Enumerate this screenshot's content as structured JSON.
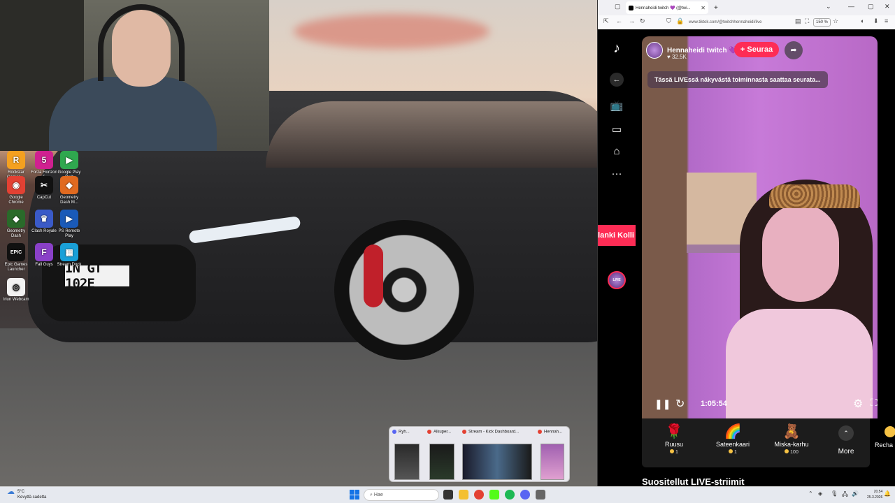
{
  "desktop": {
    "icons": [
      {
        "label": "Rockstar Games ...",
        "color": "#f4a020",
        "glyph": "R"
      },
      {
        "label": "Forza Horizon 5",
        "color": "#d02090",
        "glyph": "5"
      },
      {
        "label": "Google Play Pelit",
        "color": "#2fa84f",
        "glyph": "▶"
      },
      {
        "label": "Google Chrome",
        "color": "#e34133",
        "glyph": "◉"
      },
      {
        "label": "CapCut",
        "color": "#111111",
        "glyph": "✂"
      },
      {
        "label": "Geometry Dash M...",
        "color": "#e06a20",
        "glyph": "◆"
      },
      {
        "label": "Geometry Dash",
        "color": "#2a6a2a",
        "glyph": "◆"
      },
      {
        "label": "Clash Royale",
        "color": "#3a5ac8",
        "glyph": "♛"
      },
      {
        "label": "PS Remote Play",
        "color": "#1a5ab8",
        "glyph": "▶"
      },
      {
        "label": "Epic Games Launcher",
        "color": "#111111",
        "glyph": "EPIC"
      },
      {
        "label": "Fall Guys",
        "color": "#8a40c8",
        "glyph": "F"
      },
      {
        "label": "Stream Dock",
        "color": "#1aa0d8",
        "glyph": "▦"
      },
      {
        "label": "Iriun Webcam",
        "color": "#f2f2f2",
        "glyph": "◎"
      }
    ],
    "plate_text": "IN GT 102E"
  },
  "browser": {
    "tab_title": "Hennaheidi twitch 💜 (@twi...",
    "url": "www.tiktok.com/@twitchhennaheidi/live",
    "zoom": "150 %"
  },
  "tiktok": {
    "banner_text": "lanki Kolli",
    "live_badge": "LIVE",
    "streamer_name": "Hennaheidi twitch 💜",
    "likes": "32.5K",
    "follow_label": "+ Seuraa",
    "notice": "Tässä LIVEssä näkyvästä toiminnasta saattaa seurata...",
    "elapsed": "1:05:54",
    "gifts": [
      {
        "name": "Ruusu",
        "price": "1",
        "icon": "🌹"
      },
      {
        "name": "Sateenkaari",
        "price": "1",
        "icon": "🌈"
      },
      {
        "name": "Miska-karhu",
        "price": "100",
        "icon": "🧸"
      }
    ],
    "more_label": "More",
    "recharge_label": "Recha",
    "suggested_heading": "Suositellut LIVE-striimit"
  },
  "task_thumbs": [
    {
      "title": "Ryh...",
      "color": "#5865f2"
    },
    {
      "title": "Alkuper...",
      "color": "#e34133"
    },
    {
      "title": "Stream - Kick Dashboard...",
      "color": "#e34133"
    },
    {
      "title": "Hennah...",
      "color": "#e34133"
    }
  ],
  "taskbar": {
    "weather_temp": "5°C",
    "weather_desc": "Kevyttä sadetta",
    "search_placeholder": "Hae",
    "time": "20.54",
    "date": "25.3.2026"
  }
}
